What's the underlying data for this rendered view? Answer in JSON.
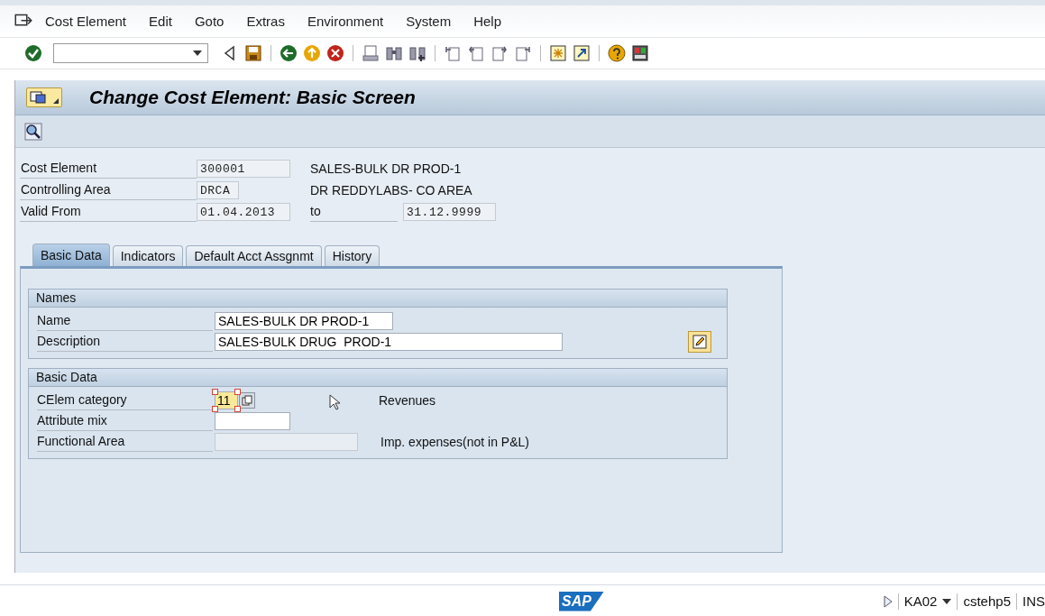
{
  "menu_bar": {
    "items": [
      "Cost Element",
      "Edit",
      "Goto",
      "Extras",
      "Environment",
      "System",
      "Help"
    ]
  },
  "title": "Change Cost Element: Basic Screen",
  "header_fields": [
    {
      "label": "Cost Element",
      "value": "300001",
      "editable": false,
      "text": "SALES-BULK DR PROD-1"
    },
    {
      "label": "Controlling Area",
      "value": "DRCA",
      "editable": false,
      "text": "DR REDDYLABS- CO AREA"
    },
    {
      "label": "Valid From",
      "value": "01.04.2013",
      "editable": false,
      "to_label": "to",
      "to_value": "31.12.9999"
    }
  ],
  "tabs": [
    {
      "label": "Basic Data",
      "selected": true
    },
    {
      "label": "Indicators",
      "selected": false
    },
    {
      "label": "Default Acct Assgnmt",
      "selected": false
    },
    {
      "label": "History",
      "selected": false
    }
  ],
  "groups": [
    {
      "title": "Names",
      "fields": [
        {
          "label": "Name",
          "value": "SALES-BULK DR PROD-1",
          "editable": true
        },
        {
          "label": "Description",
          "value": "SALES-BULK DRUG  PROD-1",
          "editable": true
        }
      ]
    },
    {
      "title": "Basic Data",
      "fields": [
        {
          "label": "CElem category",
          "value": "11",
          "editable": true,
          "focused": true,
          "text": "Revenues"
        },
        {
          "label": "Attribute mix",
          "editable": true
        },
        {
          "label": "Functional Area",
          "editable": false,
          "text": "Imp. expenses(not in P&L)"
        }
      ]
    }
  ],
  "status_bar": {
    "logo": "SAP",
    "transaction": "KA02",
    "server": "cstehp5",
    "mode": "INS"
  }
}
